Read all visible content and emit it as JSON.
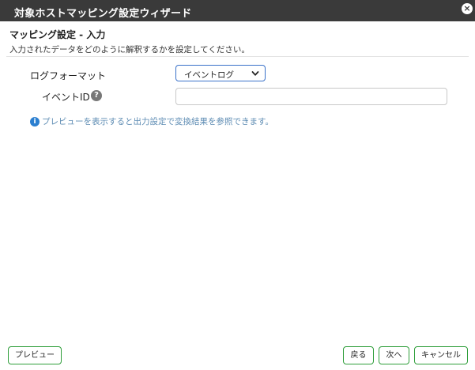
{
  "window": {
    "title": "対象ホストマッピング設定ウィザード",
    "close_symbol": "×"
  },
  "section": {
    "title": "マッピング設定 - 入力",
    "description": "入力されたデータをどのように解釈するかを設定してください。"
  },
  "form": {
    "log_format": {
      "label": "ログフォーマット",
      "selected": "イベントログ"
    },
    "event_id": {
      "label": "イベントID",
      "value": "",
      "help_symbol": "?"
    }
  },
  "info": {
    "icon_symbol": "i",
    "text": "プレビューを表示すると出力設定で変換結果を参照できます。"
  },
  "buttons": {
    "preview": "プレビュー",
    "back": "戻る",
    "next": "次へ",
    "cancel": "キャンセル"
  },
  "colors": {
    "titlebar": "#3a3a3a",
    "button_border": "#2e9e3a",
    "select_border": "#3a72c9",
    "info_text": "#5f8db4",
    "info_icon": "#2b7fd0"
  },
  "icons": {
    "close": "close-icon",
    "help": "help-icon",
    "info": "info-icon",
    "dropdown": "chevron-down-icon"
  }
}
